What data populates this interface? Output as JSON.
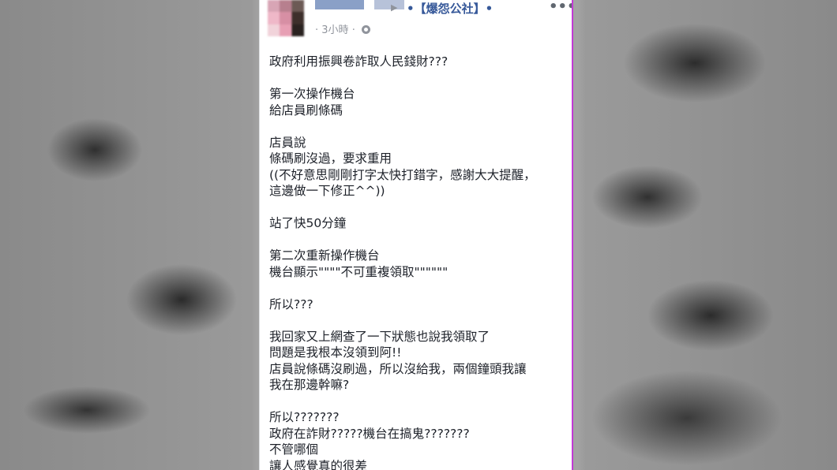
{
  "post": {
    "group_name": "•【爆怨公社】•",
    "time": "3小時",
    "time_sep": "·",
    "menu": "•••",
    "separator_arrow": "▶",
    "lines": [
      "政府利用振興卷詐取人民錢財???",
      "",
      "第一次操作機台",
      "給店員刷條碼",
      "",
      "店員說",
      "條碼刷沒過，要求重用",
      "((不好意思剛剛打字太快打錯字，感謝大大提醒，",
      "這邊做一下修正^^))",
      "",
      "站了快50分鐘",
      "",
      "第二次重新操作機台",
      "機台顯示\"\"\"\"不可重複領取\"\"\"\"\"\"",
      "",
      "所以???",
      "",
      "我回家又上網查了一下狀態也說我領取了",
      "問題是我根本沒領到阿!!",
      "店員說條碼沒刷過，所以沒給我，兩個鐘頭我讓",
      "我在那邊幹嘛?",
      "",
      "所以???????",
      "政府在詐財?????機台在搞鬼???????",
      "不管哪個",
      "讓人感覺真的很差"
    ]
  }
}
